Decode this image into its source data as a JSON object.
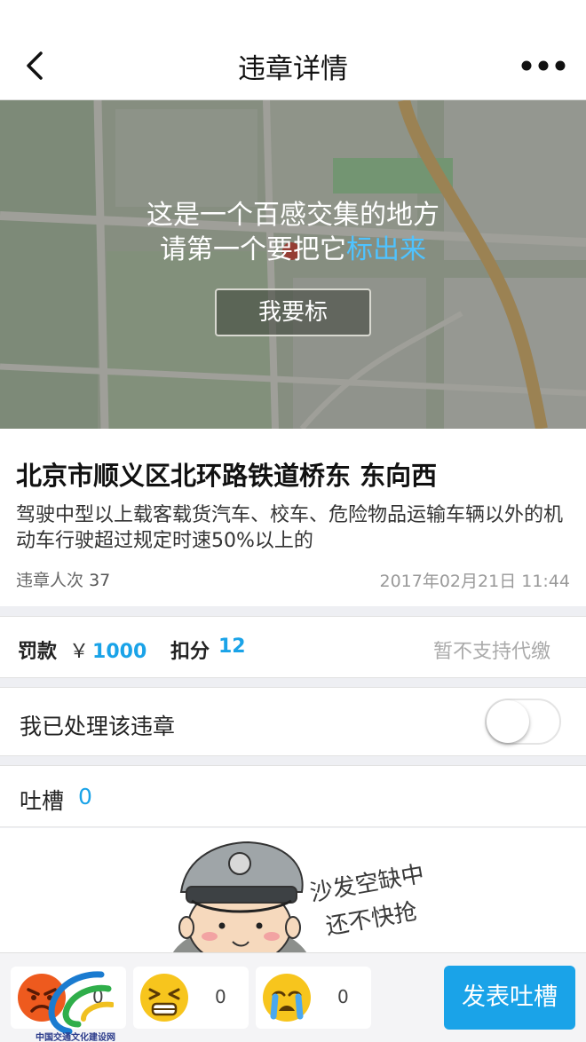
{
  "nav": {
    "title": "违章详情",
    "back_icon": "chevron-left-icon",
    "more_icon": "more-dots-icon"
  },
  "map": {
    "line1": "这是一个百感交集的地方",
    "line2_prefix": "请第一个要把它",
    "line2_highlight": "标出来",
    "mark_button": "我要标",
    "highlight_color": "#4fc3ff"
  },
  "violation": {
    "location": "北京市顺义区北环路铁道桥东 东向西",
    "description": "驾驶中型以上载客载货汽车、校车、危险物品运输车辆以外的机动车行驶超过规定时速50%以上的",
    "count_label": "违章人次",
    "count": "37",
    "datetime": "2017年02月21日 11:44"
  },
  "penalty": {
    "fine_label": "罚款",
    "currency": "￥",
    "fine_amount": "1000",
    "points_label": "扣分",
    "points": "12",
    "proxy_status": "暂不支持代缴",
    "accent_color": "#1aa3e8"
  },
  "handled": {
    "label": "我已处理该违章",
    "toggle_on": false
  },
  "comments": {
    "label": "吐槽",
    "count": "0"
  },
  "empty_state": {
    "line1": "沙发空缺中",
    "line2": "还不快抢"
  },
  "bottom": {
    "reactions": [
      {
        "icon": "angry-face-icon",
        "count": "0"
      },
      {
        "icon": "grimace-face-icon",
        "count": "0"
      },
      {
        "icon": "crying-face-icon",
        "count": "0"
      }
    ],
    "post_button": "发表吐槽"
  },
  "watermark": {
    "text": "中国交通文化建设网"
  }
}
